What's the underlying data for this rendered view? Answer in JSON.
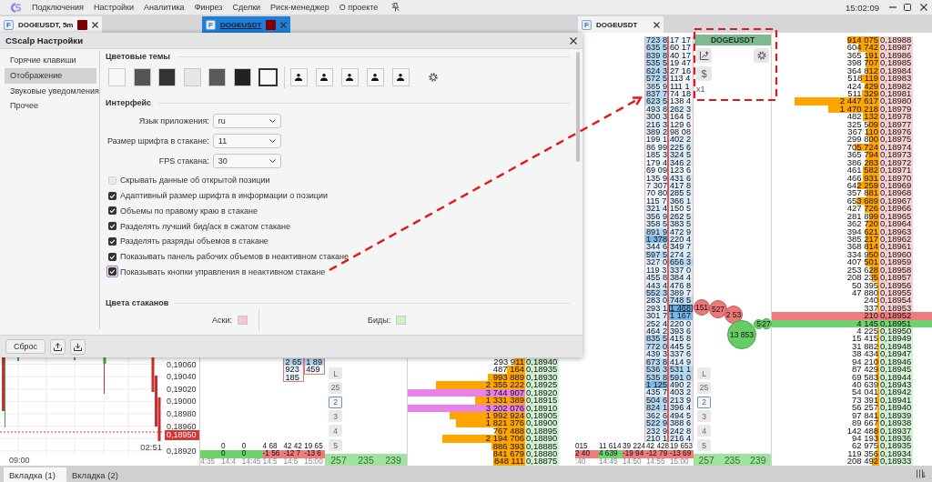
{
  "menu_bar": {
    "items": [
      "Подключения",
      "Настройки",
      "Аналитика",
      "Финрез",
      "Сделки",
      "Риск-менеджер",
      "О проекте"
    ],
    "clock": "15:02:09"
  },
  "chart_panel": {
    "tab": {
      "badge": "F",
      "label": "DOGEUSDT, 5m",
      "color": "#800000",
      "selected": false
    },
    "price_labels": [
      "0,19060",
      "0,19040",
      "0,19020",
      "0,19000",
      "0,18980",
      "0,18960",
      "0,18920"
    ],
    "current_price": "0,18950",
    "candle_time": "02:51",
    "time_labels": [
      "09:00"
    ]
  },
  "dom_panel": {
    "tab": {
      "badge": "F",
      "label": "DOGEUSDT",
      "color": "#800000",
      "selected": true
    },
    "cluster_columns": [
      {
        "cells": [
          {
            "text": "2 65",
            "kind": "medium"
          },
          {
            "text": "923",
            "kind": "faint"
          },
          {
            "text": "185",
            "kind": "faint"
          }
        ]
      },
      {
        "cells": [
          {
            "text": "1 89",
            "kind": "medium"
          },
          {
            "text": "459",
            "kind": "faint"
          }
        ]
      }
    ],
    "cluster_footer": [
      {
        "time": "4:35",
        "kind": "positive"
      },
      {
        "volume": "0",
        "delta": "0",
        "kind": "positive",
        "time": "14:4"
      },
      {
        "volume": "0",
        "delta": "0",
        "kind": "positive",
        "time": "14:45"
      },
      {
        "volume": "4 68",
        "delta": "-1 56",
        "kind": "negative",
        "time": "14:5"
      },
      {
        "volume": "42 42",
        "delta": "-12 7",
        "kind": "negative",
        "time": "14:5"
      },
      {
        "volume": "19 65",
        "delta": "-13 6",
        "kind": "negative",
        "time": "15:00"
      }
    ],
    "scale_buttons": [
      {
        "label": "L",
        "selected": false
      },
      {
        "label": "25",
        "selected": false
      },
      {
        "label": "2",
        "selected": true
      },
      {
        "label": "3",
        "selected": false
      },
      {
        "label": "4",
        "selected": false
      },
      {
        "label": "5",
        "selected": false
      }
    ],
    "totals": [
      "257",
      "235",
      "239"
    ],
    "rows": [
      {
        "volume": "293 911",
        "price": "0,18940",
        "kind": "bid"
      },
      {
        "volume": "487 164",
        "price": "0,18935",
        "kind": "bid"
      },
      {
        "volume": "993 889",
        "price": "0,18930",
        "kind": "bid"
      },
      {
        "volume": "2 355 222",
        "price": "0,18925",
        "kind": "bid"
      },
      {
        "volume": "3 744 907",
        "price": "0,18920",
        "kind": "bid"
      },
      {
        "volume": "1 331 389",
        "price": "0,18915",
        "kind": "bid"
      },
      {
        "volume": "3 202 076",
        "price": "0,18910",
        "kind": "bid"
      },
      {
        "volume": "1 992 924",
        "price": "0,18905",
        "kind": "bid"
      },
      {
        "volume": "1 821 376",
        "price": "0,18900",
        "kind": "bid"
      },
      {
        "volume": "767 488",
        "price": "0,18895",
        "kind": "bid"
      },
      {
        "volume": "2 194 706",
        "price": "0,18890",
        "kind": "bid"
      },
      {
        "volume": "886 393",
        "price": "0,18885",
        "kind": "bid"
      },
      {
        "volume": "841 679",
        "price": "0,18880",
        "kind": "bid"
      },
      {
        "volume": "848 111",
        "price": "0,18875",
        "kind": "bid"
      }
    ]
  },
  "right_dom": {
    "tab": {
      "badge": "F",
      "label": "DOGEUSDT",
      "selected": false
    },
    "controls": {
      "title": "DOGEUSDT",
      "currency_button": "$",
      "multiplier": "x1"
    },
    "cluster_columns": [
      {
        "cells": [
          {
            "text": "723 8",
            "kind": "medium"
          },
          {
            "text": "635 5",
            "kind": "medium"
          },
          {
            "text": "839 8",
            "kind": "medium"
          },
          {
            "text": "535 5",
            "kind": "medium"
          },
          {
            "text": "624 3",
            "kind": "medium"
          },
          {
            "text": "572 5",
            "kind": "medium"
          },
          {
            "text": "385 9",
            "kind": "light"
          },
          {
            "text": "837 7",
            "kind": "medium"
          },
          {
            "text": "623 5",
            "kind": "medium"
          },
          {
            "text": "493 8",
            "kind": "light"
          },
          {
            "text": "300 3",
            "kind": "light"
          },
          {
            "text": "216 3",
            "kind": "light"
          },
          {
            "text": "389 2",
            "kind": "light"
          },
          {
            "text": "199 1",
            "kind": "faint"
          },
          {
            "text": "86 99",
            "kind": "faint"
          },
          {
            "text": "185 3",
            "kind": "faint"
          },
          {
            "text": "179 4",
            "kind": "faint"
          },
          {
            "text": "69 09",
            "kind": "faint"
          },
          {
            "text": "135 9",
            "kind": "faint"
          },
          {
            "text": "7 307",
            "kind": "faint"
          },
          {
            "text": "70 80",
            "kind": "faint"
          },
          {
            "text": "115 7",
            "kind": "faint"
          },
          {
            "text": "321 4",
            "kind": "light"
          },
          {
            "text": "356 9",
            "kind": "light"
          },
          {
            "text": "358 5",
            "kind": "light"
          },
          {
            "text": "891 9",
            "kind": "medium"
          },
          {
            "text": "1 378",
            "kind": "dark"
          },
          {
            "text": "344 6",
            "kind": "light"
          },
          {
            "text": "597 5",
            "kind": "medium"
          },
          {
            "text": "327 0",
            "kind": "light"
          },
          {
            "text": "119 3",
            "kind": "faint"
          },
          {
            "text": "455 8",
            "kind": "light"
          },
          {
            "text": "443 4",
            "kind": "light"
          },
          {
            "text": "552 3",
            "kind": "medium"
          },
          {
            "text": "283 0",
            "kind": "light"
          },
          {
            "text": "293 1",
            "kind": "light"
          },
          {
            "text": "301 7",
            "kind": "light"
          },
          {
            "text": "252 4",
            "kind": "light"
          },
          {
            "text": "464 2",
            "kind": "light"
          },
          {
            "text": "835 5",
            "kind": "medium"
          },
          {
            "text": "772 0",
            "kind": "medium"
          },
          {
            "text": "439 3",
            "kind": "light"
          },
          {
            "text": "673 8",
            "kind": "medium"
          },
          {
            "text": "536 3",
            "kind": "medium"
          },
          {
            "text": "535 8",
            "kind": "medium"
          },
          {
            "text": "1 125",
            "kind": "dark"
          },
          {
            "text": "435 7",
            "kind": "light"
          },
          {
            "text": "504 6",
            "kind": "medium"
          },
          {
            "text": "824 1",
            "kind": "medium"
          },
          {
            "text": "362 6",
            "kind": "light"
          },
          {
            "text": "522 9",
            "kind": "medium"
          },
          {
            "text": "232 9",
            "kind": "light"
          },
          {
            "text": "210 1",
            "kind": "light"
          }
        ]
      },
      {
        "cells": [
          {
            "text": "17 17",
            "kind": "faint"
          },
          {
            "text": "60 17",
            "kind": "faint"
          },
          {
            "text": "40 17",
            "kind": "faint"
          },
          {
            "text": "19 47",
            "kind": "faint"
          },
          {
            "text": "27 16",
            "kind": "faint"
          },
          {
            "text": "113 4",
            "kind": "faint"
          },
          {
            "text": "111 1",
            "kind": "faint"
          },
          {
            "text": "74 18",
            "kind": "faint"
          },
          {
            "text": "138 4",
            "kind": "faint"
          },
          {
            "text": "262 3",
            "kind": "light"
          },
          {
            "text": "164 5",
            "kind": "faint"
          },
          {
            "text": "129 6",
            "kind": "faint"
          },
          {
            "text": "98 08",
            "kind": "faint"
          },
          {
            "text": "402 2",
            "kind": "light"
          },
          {
            "text": "225 6",
            "kind": "light"
          },
          {
            "text": "324 5",
            "kind": "light"
          },
          {
            "text": "346 2",
            "kind": "light"
          },
          {
            "text": "123 6",
            "kind": "faint"
          },
          {
            "text": "431 6",
            "kind": "light"
          },
          {
            "text": "417 8",
            "kind": "light"
          },
          {
            "text": "285 5",
            "kind": "light"
          },
          {
            "text": "366 1",
            "kind": "light"
          },
          {
            "text": "150 5",
            "kind": "faint"
          },
          {
            "text": "262 5",
            "kind": "light"
          },
          {
            "text": "383 5",
            "kind": "light"
          },
          {
            "text": "472 9",
            "kind": "light"
          },
          {
            "text": "220 4",
            "kind": "light"
          },
          {
            "text": "349 7",
            "kind": "light"
          },
          {
            "text": "274 2",
            "kind": "light"
          },
          {
            "text": "656 3",
            "kind": "medium"
          },
          {
            "text": "337 0",
            "kind": "light"
          },
          {
            "text": "384 4",
            "kind": "light"
          },
          {
            "text": "476 8",
            "kind": "light"
          },
          {
            "text": "389 7",
            "kind": "light"
          },
          {
            "text": "748 5",
            "kind": "medium"
          },
          {
            "text": "1 468",
            "kind": "current"
          },
          {
            "text": "1 167",
            "kind": "dark"
          },
          {
            "text": "220 0",
            "kind": "light"
          },
          {
            "text": "393 6",
            "kind": "light"
          },
          {
            "text": "415 8",
            "kind": "light"
          },
          {
            "text": "445 5",
            "kind": "light"
          },
          {
            "text": "337 6",
            "kind": "light"
          },
          {
            "text": "414 9",
            "kind": "light"
          },
          {
            "text": "531 1",
            "kind": "medium"
          },
          {
            "text": "591 0",
            "kind": "medium"
          },
          {
            "text": "490 2",
            "kind": "light"
          },
          {
            "text": "403 2",
            "kind": "light"
          },
          {
            "text": "213 9",
            "kind": "light"
          },
          {
            "text": "396 4",
            "kind": "light"
          },
          {
            "text": "494 5",
            "kind": "light"
          },
          {
            "text": "388 6",
            "kind": "light"
          },
          {
            "text": "242 8",
            "kind": "light"
          },
          {
            "text": "216 4",
            "kind": "light"
          }
        ]
      }
    ],
    "cluster_footer": [
      {
        "volume": "015",
        "delta": "2 40",
        "kind": "negative",
        "time": ":40"
      },
      {
        "volume": "11 614",
        "delta": "4 639",
        "kind": "positive",
        "time": "14:45"
      },
      {
        "volume": "39 224",
        "delta": "-19 94",
        "kind": "negative",
        "time": "14:50"
      },
      {
        "volume": "42 428",
        "delta": "-12 79",
        "kind": "negative",
        "time": "14:55"
      },
      {
        "volume": "19 653",
        "delta": "-13 69",
        "kind": "negative",
        "time": "15:00"
      }
    ],
    "bubbles": [
      {
        "label": "151",
        "kind": "sell"
      },
      {
        "label": "527",
        "kind": "sell"
      },
      {
        "label": "2 53",
        "kind": "sell"
      },
      {
        "label": "13 853",
        "kind": "buy"
      },
      {
        "label": "5",
        "kind": "buy"
      },
      {
        "label": "27",
        "kind": "buy"
      }
    ],
    "scale_buttons": [
      {
        "label": "L",
        "selected": false
      },
      {
        "label": "25",
        "selected": false
      },
      {
        "label": "2",
        "selected": true
      },
      {
        "label": "3",
        "selected": false
      },
      {
        "label": "4",
        "selected": false
      },
      {
        "label": "5",
        "selected": false
      }
    ],
    "totals": [
      "257",
      "235",
      "239"
    ],
    "rows": [
      {
        "volume": "914 075",
        "price": "0,18988",
        "kind": "ask"
      },
      {
        "volume": "604 742",
        "price": "0,18987",
        "kind": "ask"
      },
      {
        "volume": "365 191",
        "price": "0,18986",
        "kind": "ask"
      },
      {
        "volume": "398 707",
        "price": "0,18985",
        "kind": "ask"
      },
      {
        "volume": "364 812",
        "price": "0,18984",
        "kind": "ask"
      },
      {
        "volume": "518 119",
        "price": "0,18983",
        "kind": "ask"
      },
      {
        "volume": "424 429",
        "price": "0,18982",
        "kind": "ask"
      },
      {
        "volume": "511 329",
        "price": "0,18981",
        "kind": "ask"
      },
      {
        "volume": "2 447 617",
        "price": "0,18980",
        "kind": "ask"
      },
      {
        "volume": "1 470 218",
        "price": "0,18979",
        "kind": "ask"
      },
      {
        "volume": "482 132",
        "price": "0,18978",
        "kind": "ask"
      },
      {
        "volume": "325 509",
        "price": "0,18977",
        "kind": "ask"
      },
      {
        "volume": "367 110",
        "price": "0,18976",
        "kind": "ask"
      },
      {
        "volume": "299 800",
        "price": "0,18975",
        "kind": "ask"
      },
      {
        "volume": "705 724",
        "price": "0,18974",
        "kind": "ask"
      },
      {
        "volume": "365 794",
        "price": "0,18973",
        "kind": "ask"
      },
      {
        "volume": "386 283",
        "price": "0,18972",
        "kind": "ask"
      },
      {
        "volume": "461 582",
        "price": "0,18971",
        "kind": "ask"
      },
      {
        "volume": "466 931",
        "price": "0,18970",
        "kind": "ask"
      },
      {
        "volume": "642 259",
        "price": "0,18969",
        "kind": "ask"
      },
      {
        "volume": "357 881",
        "price": "0,18968",
        "kind": "ask"
      },
      {
        "volume": "653 689",
        "price": "0,18967",
        "kind": "ask"
      },
      {
        "volume": "427 726",
        "price": "0,18966",
        "kind": "ask"
      },
      {
        "volume": "281 899",
        "price": "0,18965",
        "kind": "ask"
      },
      {
        "volume": "362 720",
        "price": "0,18964",
        "kind": "ask"
      },
      {
        "volume": "394 621",
        "price": "0,18963",
        "kind": "ask"
      },
      {
        "volume": "385 217",
        "price": "0,18962",
        "kind": "ask"
      },
      {
        "volume": "368 814",
        "price": "0,18961",
        "kind": "ask"
      },
      {
        "volume": "334 950",
        "price": "0,18960",
        "kind": "ask"
      },
      {
        "volume": "407 501",
        "price": "0,18959",
        "kind": "ask"
      },
      {
        "volume": "253 628",
        "price": "0,18958",
        "kind": "ask"
      },
      {
        "volume": "208 235",
        "price": "0,18957",
        "kind": "ask"
      },
      {
        "volume": "50 395",
        "price": "0,18956",
        "kind": "ask"
      },
      {
        "volume": "47 880",
        "price": "0,18955",
        "kind": "ask"
      },
      {
        "volume": "240",
        "price": "0,18954",
        "kind": "ask"
      },
      {
        "volume": "337",
        "price": "0,18953",
        "kind": "ask"
      },
      {
        "volume": "210",
        "price": "0,18952",
        "kind": "best_ask"
      },
      {
        "volume": "4 145",
        "price": "0,18951",
        "kind": "best_bid"
      },
      {
        "volume": "4 225",
        "price": "0,18950",
        "kind": "bid"
      },
      {
        "volume": "15 415",
        "price": "0,18949",
        "kind": "bid"
      },
      {
        "volume": "31 882",
        "price": "0,18948",
        "kind": "bid"
      },
      {
        "volume": "38 434",
        "price": "0,18947",
        "kind": "bid"
      },
      {
        "volume": "94 210",
        "price": "0,18946",
        "kind": "bid"
      },
      {
        "volume": "87 429",
        "price": "0,18945",
        "kind": "bid"
      },
      {
        "volume": "69 583",
        "price": "0,18944",
        "kind": "bid"
      },
      {
        "volume": "40 639",
        "price": "0,18943",
        "kind": "bid"
      },
      {
        "volume": "54 041",
        "price": "0,18942",
        "kind": "bid"
      },
      {
        "volume": "73 391",
        "price": "0,18941",
        "kind": "bid"
      },
      {
        "volume": "56 257",
        "price": "0,18940",
        "kind": "bid"
      },
      {
        "volume": "97 841",
        "price": "0,18939",
        "kind": "bid"
      },
      {
        "volume": "89 667",
        "price": "0,18938",
        "kind": "bid"
      },
      {
        "volume": "142 488",
        "price": "0,18937",
        "kind": "bid"
      },
      {
        "volume": "94 193",
        "price": "0,18936",
        "kind": "bid"
      },
      {
        "volume": "62 975",
        "price": "0,18935",
        "kind": "bid"
      },
      {
        "volume": "119 356",
        "price": "0,18934",
        "kind": "bid"
      },
      {
        "volume": "208 492",
        "price": "0,18933",
        "kind": "bid"
      }
    ]
  },
  "settings_dialog": {
    "title": "CScalp Настройки",
    "sidebar": [
      {
        "label": "Горячие клавиши",
        "selected": false
      },
      {
        "label": "Отображение",
        "selected": true
      },
      {
        "label": "Звуковые уведомления",
        "selected": false
      },
      {
        "label": "Прочее",
        "selected": false
      }
    ],
    "color_themes": {
      "heading": "Цветовые темы",
      "themes": [
        {
          "color": "#f7f7f7",
          "selected": false
        },
        {
          "color": "#555555",
          "selected": false
        },
        {
          "color": "#333333",
          "selected": false
        },
        {
          "color": "#e6e6e6",
          "selected": false
        },
        {
          "color": "#595959",
          "selected": false
        },
        {
          "color": "#222222",
          "selected": false
        },
        {
          "color": "#f7f7f7",
          "selected": true
        }
      ],
      "icon_themes": [
        {
          "selected": false
        },
        {
          "selected": false
        },
        {
          "selected": false
        },
        {
          "selected": false
        },
        {
          "selected": false
        }
      ]
    },
    "interface": {
      "heading": "Интерфейс",
      "selects": [
        {
          "label": "Язык приложения:",
          "value": "ru"
        },
        {
          "label": "Размер шрифта в стакане:",
          "value": "11"
        },
        {
          "label": "FPS стакана:",
          "value": "30"
        }
      ],
      "checkboxes": [
        {
          "label": "Скрывать данные об открытой позиции",
          "checked": false,
          "focused": false
        },
        {
          "label": "Адаптивный размер шрифта в информации о позиции",
          "checked": true,
          "focused": false
        },
        {
          "label": "Объемы по правому краю в стакане",
          "checked": true,
          "focused": false
        },
        {
          "label": "Разделять лучший бид/аск в сжатом стакане",
          "checked": true,
          "focused": false
        },
        {
          "label": "Разделять разряды объемов в стакане",
          "checked": true,
          "focused": false
        },
        {
          "label": "Показывать панель рабочих объемов в неактивном стакане",
          "checked": true,
          "focused": false
        },
        {
          "label": "Показывать кнопки управления в неактивном стакане",
          "checked": true,
          "focused": true
        }
      ]
    },
    "dom_colors": {
      "heading": "Цвета стаканов",
      "items": [
        {
          "label": "Аски:",
          "color": "#f8c8c8"
        },
        {
          "label": "Биды:",
          "color": "#c8f2c8"
        }
      ]
    },
    "footer": {
      "reset_button": "Сброс"
    }
  },
  "bottom_tabs": [
    {
      "label": "Вкладка (1)",
      "selected": true
    },
    {
      "label": "Вкладка (2)",
      "selected": false
    }
  ]
}
